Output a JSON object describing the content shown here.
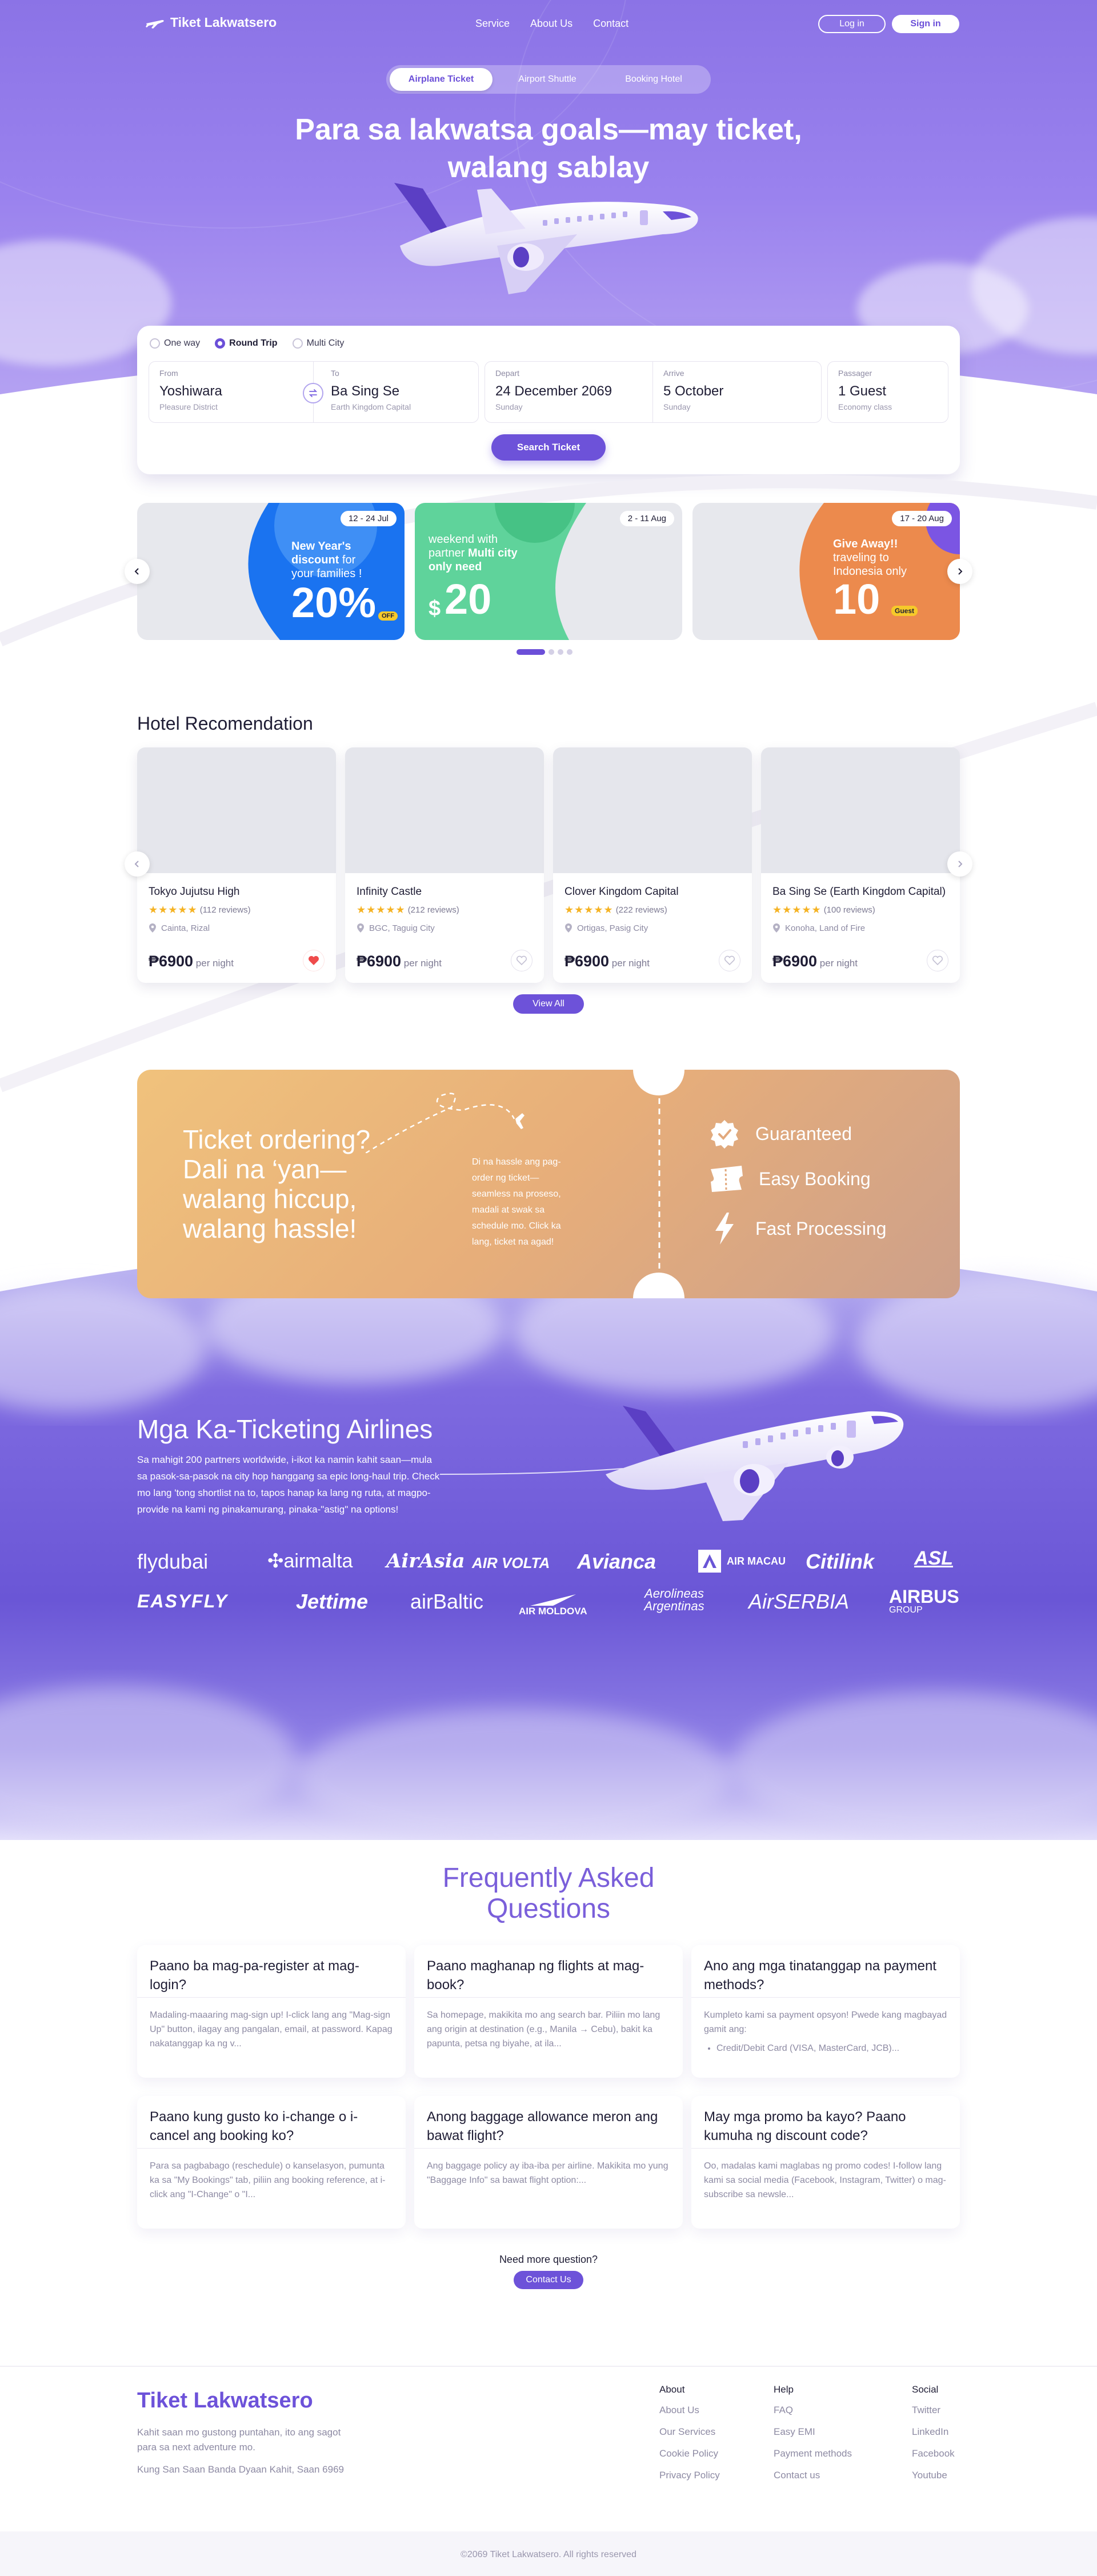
{
  "brand": {
    "name": "Tiket Lakwatsero"
  },
  "nav": {
    "links": [
      "Service",
      "About Us",
      "Contact"
    ],
    "login": "Log in",
    "signin": "Sign in"
  },
  "booking_tabs": [
    "Airplane Ticket",
    "Airport Shuttle",
    "Booking Hotel"
  ],
  "hero": {
    "title_line1": "Para sa lakwatsa goals—may ticket,",
    "title_line2": "walang sablay"
  },
  "search": {
    "trip_types": [
      "One way",
      "Round Trip",
      "Multi City"
    ],
    "selected_trip": "Round Trip",
    "from": {
      "label": "From",
      "value": "Yoshiwara",
      "sub": "Pleasure District"
    },
    "to": {
      "label": "To",
      "value": "Ba Sing Se",
      "sub": "Earth Kingdom Capital"
    },
    "depart": {
      "label": "Depart",
      "value": "24 December 2069",
      "sub": "Sunday"
    },
    "arrive": {
      "label": "Arrive",
      "value": "5 October",
      "sub": "Sunday"
    },
    "passenger": {
      "label": "Passager",
      "value": "1 Guest",
      "sub": "Economy class"
    },
    "button": "Search Ticket"
  },
  "promos": [
    {
      "date": "12 - 24 Jul",
      "line1": "New Year's",
      "line2": "discount",
      "line2b": " for",
      "line3": "your families !",
      "big": "20%",
      "badge": "OFF",
      "color": "#1a73f0"
    },
    {
      "date": "2 - 11 Aug",
      "line1": "weekend with",
      "line2": "partner ",
      "line2b": "Multi city",
      "line3": "only need",
      "big": "20",
      "currency": "$",
      "color": "#5fd39b"
    },
    {
      "date": "17 - 20 Aug",
      "line1": "Give Away!!",
      "line2": "traveling to",
      "line3": "Indonesia only",
      "big": "10",
      "badge": "Guest",
      "color": "#ec8a4d"
    }
  ],
  "hotels": {
    "title": "Hotel Recomendation",
    "view_all": "View All",
    "items": [
      {
        "name": "Tokyo Jujutsu High",
        "reviews": "(112 reviews)",
        "location": "Cainta, Rizal",
        "price": "₱6900",
        "per": " per night",
        "liked": true,
        "rating": 5
      },
      {
        "name": "Infinity Castle",
        "reviews": "(212 reviews)",
        "location": "BGC, Taguig City",
        "price": "₱6900",
        "per": " per night",
        "liked": false,
        "rating": 5
      },
      {
        "name": "Clover Kingdom Capital",
        "reviews": "(222 reviews)",
        "location": "Ortigas, Pasig City",
        "price": "₱6900",
        "per": " per night",
        "liked": false,
        "rating": 5
      },
      {
        "name": "Ba Sing Se (Earth Kingdom Capital)",
        "reviews": "(100 reviews)",
        "location": "Konoha, Land of Fire",
        "price": "₱6900",
        "per": " per night",
        "liked": false,
        "rating": 5
      }
    ]
  },
  "ticket_banner": {
    "title": [
      "Ticket ordering?",
      "Dali na ‘yan—",
      "walang hiccup,",
      "walang hassle!"
    ],
    "desc": "Di na hassle ang pag-order ng ticket—seamless na proseso, madali at swak sa schedule mo. Click ka lang, ticket na agad!",
    "features": [
      "Guaranteed",
      "Easy Booking",
      "Fast Processing"
    ]
  },
  "airlines": {
    "title": "Mga Ka-Ticketing Airlines",
    "desc": "Sa mahigit 200 partners worldwide, i-ikot ka namin kahit saan—mula sa pasok-sa-pasok na city hop hanggang sa epic long-haul trip. Check mo lang 'tong shortlist na to, tapos hanap ka lang ng ruta, at magpo-provide na kami ng pinakamurang, pinaka-\"astig\" na options!",
    "row1": [
      "flydubai",
      "airmalta",
      "AirAsia",
      "AIR VOLTA",
      "Avianca",
      "AIR MACAU",
      "Citilink",
      "ASL"
    ],
    "row2": [
      "EASYFLY",
      "Jettime",
      "airBaltic",
      "AIR MOLDOVA",
      "Aerolineas Argentinas",
      "AirSERBIA",
      "AIRBUS",
      "GROUP"
    ]
  },
  "faq": {
    "title_line1": "Frequently Asked",
    "title_line2": "Questions",
    "items": [
      {
        "q": "Paano ba mag-pa-register at mag-login?",
        "a": "Madaling-maaaring mag-sign up! I-click lang ang \"Mag-sign Up\" button, ilagay ang pangalan, email, at password. Kapag nakatanggap ka ng v..."
      },
      {
        "q": "Paano maghanap ng flights at mag-book?",
        "a": "Sa homepage, makikita mo ang search bar. Piliin mo lang ang origin at destination (e.g., Manila → Cebu), bakit ka papunta, petsa ng biyahe, at ila..."
      },
      {
        "q": "Ano ang mga tinatanggap na payment methods?",
        "a": "Kumpleto kami sa payment opsyon! Pwede kang magbayad gamit ang:",
        "bullet": "Credit/Debit Card (VISA, MasterCard, JCB)..."
      },
      {
        "q": "Paano kung gusto ko i-change o i-cancel ang booking ko?",
        "a": "Para sa pagbabago (reschedule) o kanselasyon, pumunta ka sa \"My Bookings\" tab, piliin ang booking reference, at i-click ang \"I-Change\" o \"I..."
      },
      {
        "q": "Anong baggage allowance meron ang bawat flight?",
        "a": "Ang baggage policy ay iba-iba per airline. Makikita mo yung \"Baggage Info\" sa bawat flight option:..."
      },
      {
        "q": "May mga promo ba kayo? Paano kumuha ng discount code?",
        "a": "Oo, madalas kami maglabas ng promo codes! I-follow lang kami sa social media (Facebook, Instagram, Twitter) o mag-subscribe sa newsle..."
      }
    ],
    "need_more": "Need more question?",
    "contact": "Contact Us"
  },
  "footer": {
    "brand": "Tiket Lakwatsero",
    "tagline": "Kahit saan mo gustong puntahan, ito ang sagot para sa next adventure mo.",
    "address": "Kung San Saan Banda Dyaan Kahit, Saan 6969",
    "columns": [
      {
        "title": "About",
        "items": [
          "About Us",
          "Our Services",
          "Cookie Policy",
          "Privacy Policy"
        ]
      },
      {
        "title": "Help",
        "items": [
          "FAQ",
          "Easy EMI",
          "Payment  methods",
          "Contact us"
        ]
      },
      {
        "title": "Social",
        "items": [
          "Twitter",
          "LinkedIn",
          "Facebook",
          "Youtube"
        ]
      }
    ],
    "copyright": "©2069 Tiket Lakwatsero. All rights reserved"
  },
  "colors": {
    "primary": "#6d52d9",
    "hero": "#8b73e6",
    "accent_heart": "#ef4b4b",
    "star": "#f5b324"
  }
}
